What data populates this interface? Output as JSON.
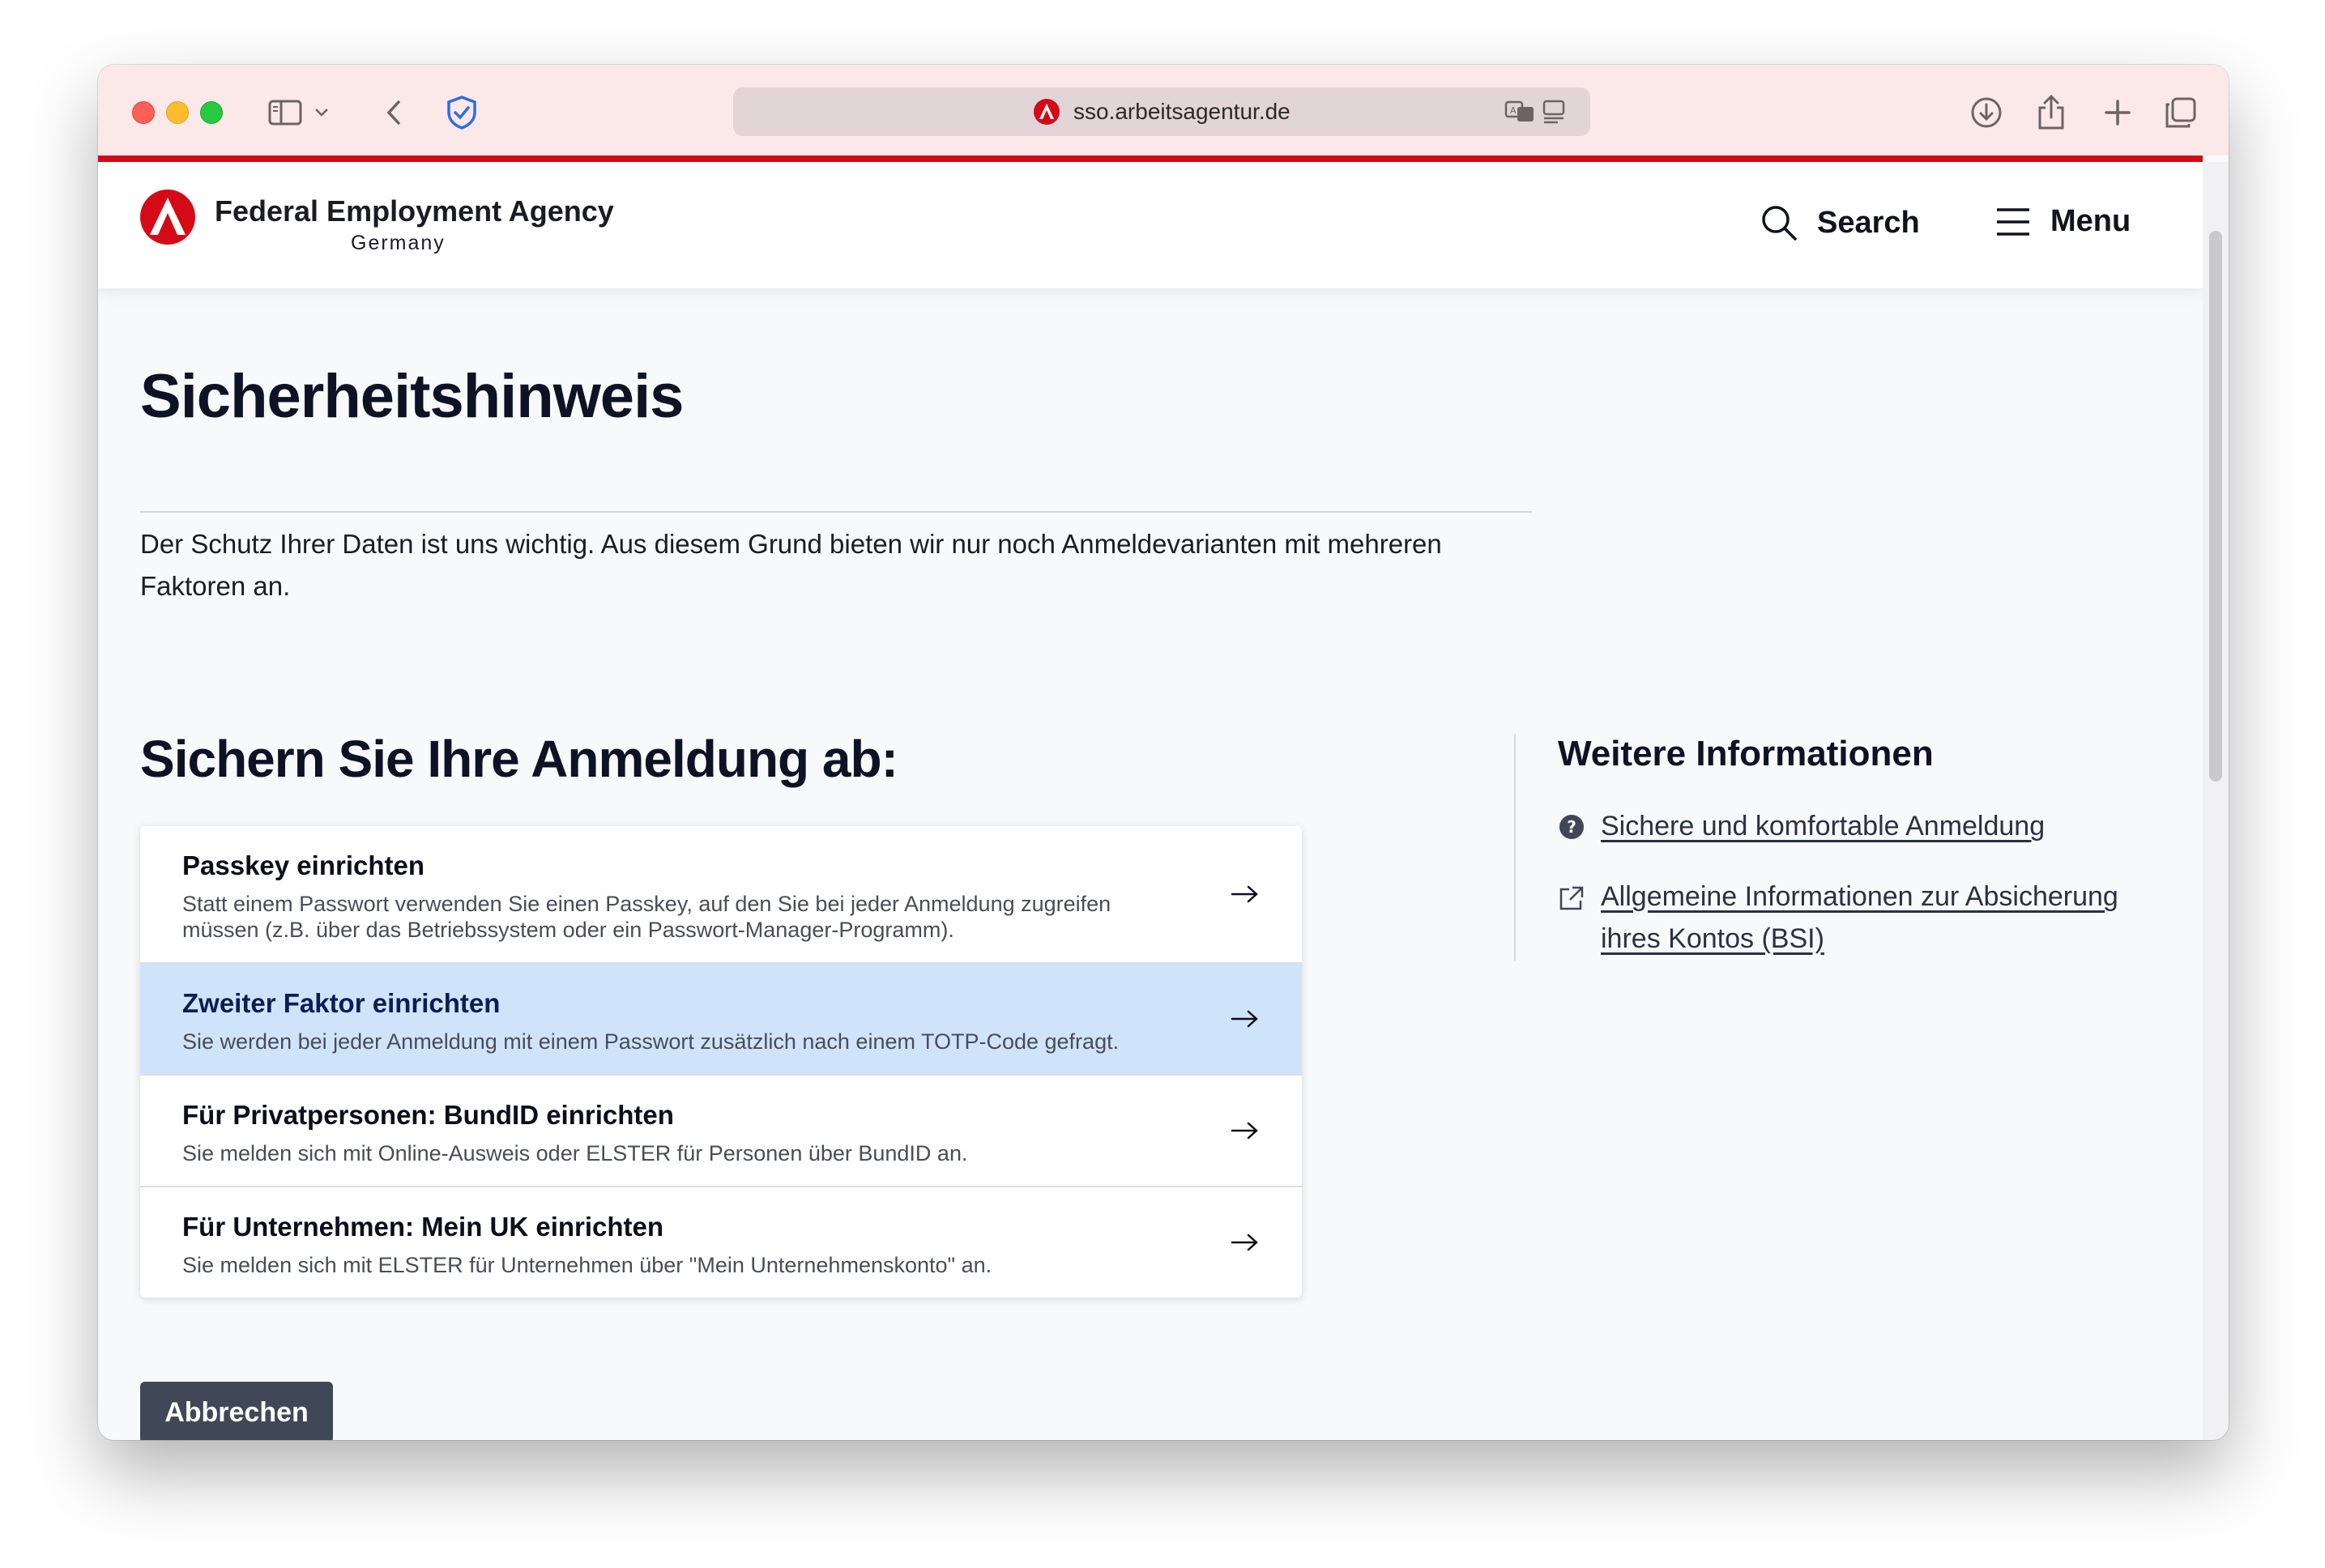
{
  "browser": {
    "url": "sso.arbeitsagentur.de"
  },
  "header": {
    "brand_name": "Federal Employment Agency",
    "brand_country": "Germany",
    "search_label": "Search",
    "menu_label": "Menu"
  },
  "main": {
    "title": "Sicherheitshinweis",
    "intro": "Der Schutz Ihrer Daten ist uns wichtig. Aus diesem Grund bieten wir nur noch Anmeldevarianten mit mehreren Faktoren an.",
    "section_title": "Sichern Sie Ihre Anmeldung ab:",
    "options": [
      {
        "title": "Passkey einrichten",
        "description": "Statt einem Passwort verwenden Sie einen Passkey, auf den Sie bei jeder Anmeldung zugreifen müssen (z.B. über das Betriebssystem oder ein Passwort-Manager-Programm)."
      },
      {
        "title": "Zweiter Faktor einrichten",
        "description": "Sie werden bei jeder Anmeldung mit einem Passwort zusätzlich nach einem TOTP-Code gefragt."
      },
      {
        "title": "Für Privatpersonen: BundID einrichten",
        "description": "Sie melden sich mit Online-Ausweis oder ELSTER für Personen über BundID an."
      },
      {
        "title": "Für Unternehmen: Mein UK einrichten",
        "description": "Sie melden sich mit ELSTER für Unternehmen über \"Mein Unternehmenskonto\" an."
      }
    ],
    "cancel_label": "Abbrechen"
  },
  "sidebar": {
    "title": "Weitere Informationen",
    "links": [
      {
        "label": "Sichere und komfortable Anmeldung",
        "icon": "question-circle-icon"
      },
      {
        "label": "Allgemeine Informationen zur Absicherung ihres Kontos (BSI)",
        "icon": "external-link-icon"
      }
    ]
  },
  "colors": {
    "brand_red": "#d40b17",
    "active_option": "#cfe4fb",
    "cancel_button": "#404757"
  }
}
